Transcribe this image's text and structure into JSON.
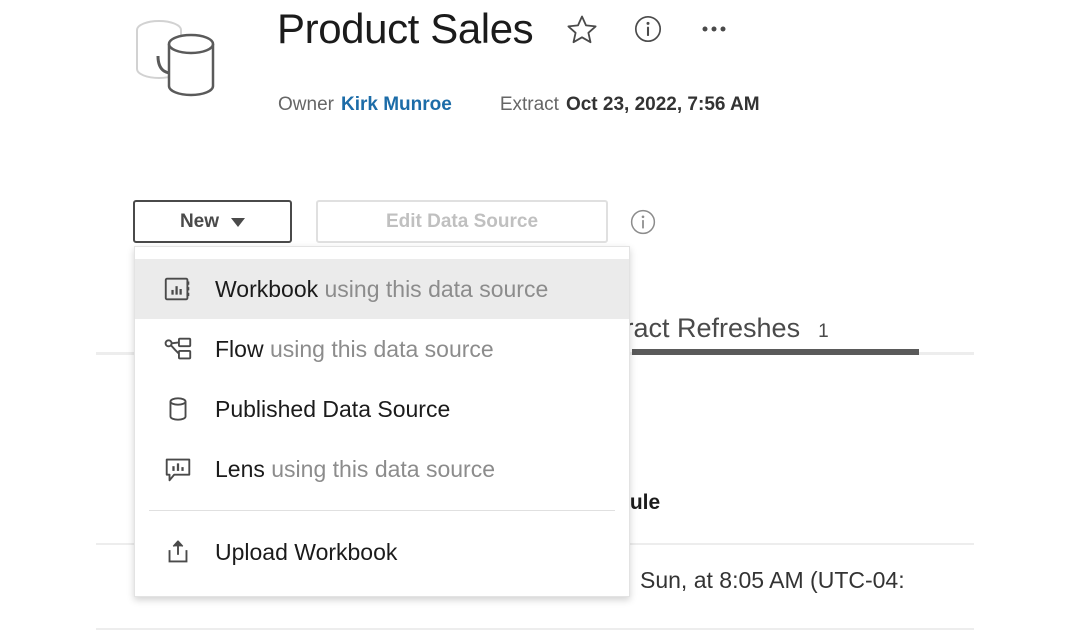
{
  "header": {
    "icon_name": "data-source-extract-icon",
    "title": "Product Sales",
    "owner_label": "Owner",
    "owner_name": "Kirk Munroe",
    "extract_label": "Extract",
    "extract_value": "Oct 23, 2022, 7:56 AM",
    "icons": [
      {
        "name": "favorite-star-icon",
        "glyph": "star"
      },
      {
        "name": "info-icon",
        "glyph": "info"
      },
      {
        "name": "more-actions-icon",
        "glyph": "ellipsis"
      }
    ]
  },
  "action_bar": {
    "new_label": "New",
    "new_caret": "chevron-down-icon",
    "edit_label": "Edit Data Source",
    "edit_disabled": true,
    "info_icon": "info-icon"
  },
  "new_menu": {
    "items": [
      {
        "icon": "workbook-icon",
        "primary": "Workbook",
        "secondary": " using this data source",
        "highlighted": true
      },
      {
        "icon": "flow-icon",
        "primary": "Flow",
        "secondary": " using this data source",
        "highlighted": false
      },
      {
        "icon": "published-data-source-icon",
        "primary": "Published Data Source",
        "secondary": "",
        "highlighted": false
      },
      {
        "icon": "lens-icon",
        "primary": "Lens",
        "secondary": " using this data source",
        "highlighted": false
      }
    ],
    "upload": {
      "icon": "upload-icon",
      "primary": "Upload Workbook",
      "secondary": ""
    }
  },
  "background": {
    "tab_label": "tract Refreshes",
    "tab_count": "1",
    "schedule_column_header": "dule",
    "schedule_row_value": "Sun, at 8:05 AM (UTC-04:"
  },
  "colors": {
    "link": "#1c6ca8",
    "text_primary": "#1b1b1b",
    "text_muted": "#8c8c8c",
    "border": "#e3e3e3",
    "highlight": "#ebebeb",
    "tab_underline": "#5a5a5a"
  }
}
